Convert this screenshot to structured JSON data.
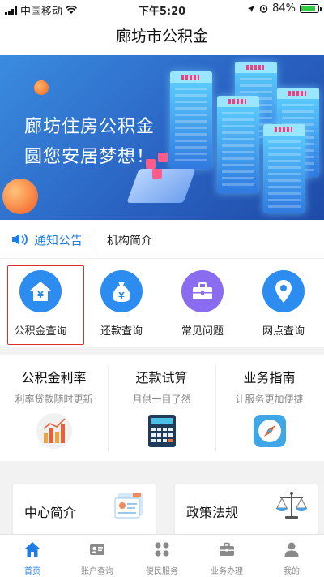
{
  "status_bar": {
    "carrier": "中国移动",
    "time": "下午5:20",
    "battery": "84%",
    "battery_level": 0.84
  },
  "navbar": {
    "title": "廊坊市公积金"
  },
  "banner": {
    "line1": "廊坊住房公积金",
    "line2": "圆您安居梦想！"
  },
  "notice": {
    "label": "通知公告",
    "link": "机构简介"
  },
  "quick_actions": [
    {
      "label": "公积金查询",
      "icon": "house-yen-icon",
      "color": "#2d8cf0"
    },
    {
      "label": "还款查询",
      "icon": "money-bag-icon",
      "color": "#2d8cf0"
    },
    {
      "label": "常见问题",
      "icon": "toolbox-icon",
      "color": "#8a6cf0"
    },
    {
      "label": "网点查询",
      "icon": "location-pin-icon",
      "color": "#2d8cf0"
    }
  ],
  "features": [
    {
      "title": "公积金利率",
      "subtitle": "利率贷款随时更新",
      "icon": "bar-chart-icon"
    },
    {
      "title": "还款试算",
      "subtitle": "月供一目了然",
      "icon": "calculator-icon"
    },
    {
      "title": "业务指南",
      "subtitle": "让服务更加便捷",
      "icon": "compass-icon"
    }
  ],
  "intro_cards": [
    {
      "title": "中心简介",
      "icon": "id-card-icon"
    },
    {
      "title": "政策法规",
      "icon": "scales-icon"
    }
  ],
  "tabbar": [
    {
      "label": "首页",
      "icon": "home-icon",
      "active": true
    },
    {
      "label": "账户查询",
      "icon": "id-card-icon",
      "active": false
    },
    {
      "label": "便民服务",
      "icon": "grid-icon",
      "active": false
    },
    {
      "label": "业务办理",
      "icon": "briefcase-icon",
      "active": false
    },
    {
      "label": "我的",
      "icon": "person-icon",
      "active": false
    }
  ],
  "colors": {
    "accent": "#1e7ee6",
    "selected_outline": "#d9302b",
    "banner_blue": "#2a63c2"
  }
}
